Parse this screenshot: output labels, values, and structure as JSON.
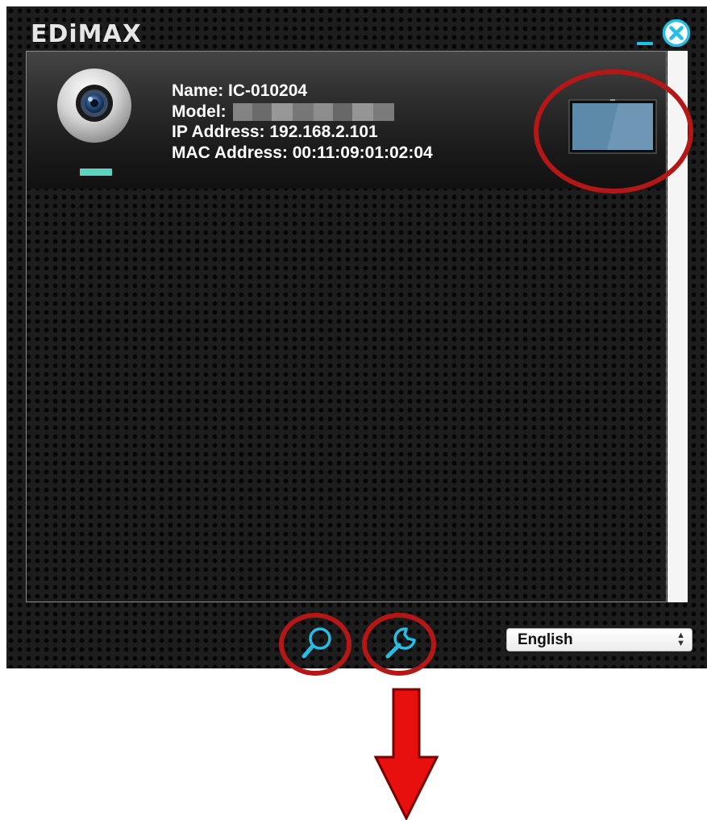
{
  "app": {
    "brand": "EDiMAX",
    "accent_color": "#24bfe6",
    "annotation_color": "#b41716"
  },
  "window_controls": {
    "minimize_icon": "minimize-icon",
    "close_icon": "close-circle-icon"
  },
  "camera_list": [
    {
      "name_line": "Name: IC-010204",
      "model_label": "Model:",
      "model_value_obscured": true,
      "ip_line": "IP Address: 192.168.2.101",
      "mac_line": "MAC Address: 00:11:09:01:02:04",
      "status_color": "#5fd2bd",
      "camera_icon": "webcam-icon",
      "view_icon": "monitor-screen-icon"
    }
  ],
  "toolbar": {
    "search_icon": "magnifier-icon",
    "settings_icon": "wrench-icon"
  },
  "language": {
    "selected": "English"
  },
  "annotations": {
    "highlighted": [
      "screen-button",
      "search-button",
      "settings-button"
    ],
    "arrow": "down-arrow"
  }
}
